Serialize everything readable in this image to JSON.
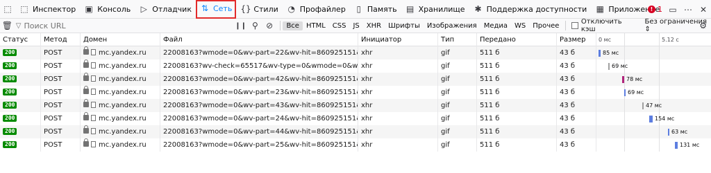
{
  "toolbar": {
    "tabs": [
      {
        "name": "inspector",
        "label": "Инспектор",
        "icon": "inspector-icon",
        "glyph": "⬚"
      },
      {
        "name": "console",
        "label": "Консоль",
        "icon": "console-icon",
        "glyph": "▣"
      },
      {
        "name": "debugger",
        "label": "Отладчик",
        "icon": "debugger-icon",
        "glyph": "▷"
      },
      {
        "name": "network",
        "label": "Сеть",
        "icon": "network-arrows-icon",
        "glyph": "⇅",
        "active": true
      },
      {
        "name": "style-editor",
        "label": "Стили",
        "icon": "braces-icon",
        "glyph": "{}"
      },
      {
        "name": "performance",
        "label": "Профайлер",
        "icon": "gauge-icon",
        "glyph": "◔"
      },
      {
        "name": "memory",
        "label": "Память",
        "icon": "memory-chip-icon",
        "glyph": "▯"
      },
      {
        "name": "storage",
        "label": "Хранилище",
        "icon": "storage-icon",
        "glyph": "▤"
      },
      {
        "name": "accessibility",
        "label": "Поддержка доступности",
        "icon": "accessibility-icon",
        "glyph": "✱"
      },
      {
        "name": "application",
        "label": "Приложение",
        "icon": "grid-icon",
        "glyph": "▦"
      }
    ],
    "error_count": "1",
    "active_color": "#0a84ff",
    "error_color": "#d70022"
  },
  "filterbar": {
    "filter_placeholder": "Поиск URL",
    "types": [
      "Все",
      "HTML",
      "CSS",
      "JS",
      "XHR",
      "Шрифты",
      "Изображения",
      "Медиа",
      "WS",
      "Прочее"
    ],
    "selected_type": "Все",
    "disable_cache_label": "Отключить кэш",
    "throttle_label": "Без ограничения"
  },
  "table": {
    "headers": {
      "status": "Статус",
      "method": "Метод",
      "domain": "Домен",
      "file": "Файл",
      "initiator": "Инициатор",
      "type": "Тип",
      "transferred": "Передано",
      "size": "Размер",
      "wf_start": "0 мс",
      "wf_end": "5.12 с"
    },
    "rows": [
      {
        "status": "200",
        "method": "POST",
        "domain": "mc.yandex.ru",
        "file": "22008163?wmode=0&wv-part=22&wv-hit=860925151&page-url=ht",
        "initiator": "xhr",
        "type": "gif",
        "transferred": "511 б",
        "size": "43 б",
        "timing": "85 мс",
        "wf_start": 0.02,
        "wf_dur": 0.017
      },
      {
        "status": "200",
        "method": "POST",
        "domain": "mc.yandex.ru",
        "file": "22008163?wv-check=65517&wv-type=0&wmode=0&wv-part=9&wv-",
        "initiator": "xhr",
        "type": "gif",
        "transferred": "511 б",
        "size": "43 б",
        "timing": "69 мс",
        "wf_start": 0.1,
        "wf_dur": 0.014
      },
      {
        "status": "200",
        "method": "POST",
        "domain": "mc.yandex.ru",
        "file": "22008163?wmode=0&wv-part=42&wv-hit=860925151&page-url=ht",
        "initiator": "xhr",
        "type": "gif",
        "transferred": "511 б",
        "size": "43 б",
        "timing": "78 мс",
        "wf_start": 0.22,
        "wf_dur": 0.016
      },
      {
        "status": "200",
        "method": "POST",
        "domain": "mc.yandex.ru",
        "file": "22008163?wmode=0&wv-part=23&wv-hit=860925151&page-url=ht",
        "initiator": "xhr",
        "type": "gif",
        "transferred": "511 б",
        "size": "43 б",
        "timing": "69 мс",
        "wf_start": 0.24,
        "wf_dur": 0.014
      },
      {
        "status": "200",
        "method": "POST",
        "domain": "mc.yandex.ru",
        "file": "22008163?wmode=0&wv-part=43&wv-hit=860925151&page-url=ht",
        "initiator": "xhr",
        "type": "gif",
        "transferred": "511 б",
        "size": "43 б",
        "timing": "47 мс",
        "wf_start": 0.4,
        "wf_dur": 0.01
      },
      {
        "status": "200",
        "method": "POST",
        "domain": "mc.yandex.ru",
        "file": "22008163?wmode=0&wv-part=24&wv-hit=860925151&page-url=ht",
        "initiator": "xhr",
        "type": "gif",
        "transferred": "511 б",
        "size": "43 б",
        "timing": "154 мс",
        "wf_start": 0.46,
        "wf_dur": 0.03
      },
      {
        "status": "200",
        "method": "POST",
        "domain": "mc.yandex.ru",
        "file": "22008163?wmode=0&wv-part=44&wv-hit=860925151&page-url=ht",
        "initiator": "xhr",
        "type": "gif",
        "transferred": "511 б",
        "size": "43 б",
        "timing": "63 мс",
        "wf_start": 0.62,
        "wf_dur": 0.013
      },
      {
        "status": "200",
        "method": "POST",
        "domain": "mc.yandex.ru",
        "file": "22008163?wmode=0&wv-part=25&wv-hit=860925151&page-url=ht",
        "initiator": "xhr",
        "type": "gif",
        "transferred": "511 б",
        "size": "43 б",
        "timing": "131 мс",
        "wf_start": 0.68,
        "wf_dur": 0.026
      }
    ],
    "status_ok_color": "#058b00",
    "wf_bar_colors": [
      "#5d7ee0",
      "#a0a0a0",
      "#b0247b",
      "#5d7ee0",
      "#a0a0a0",
      "#5d7ee0",
      "#5d7ee0",
      "#5d7ee0"
    ]
  }
}
